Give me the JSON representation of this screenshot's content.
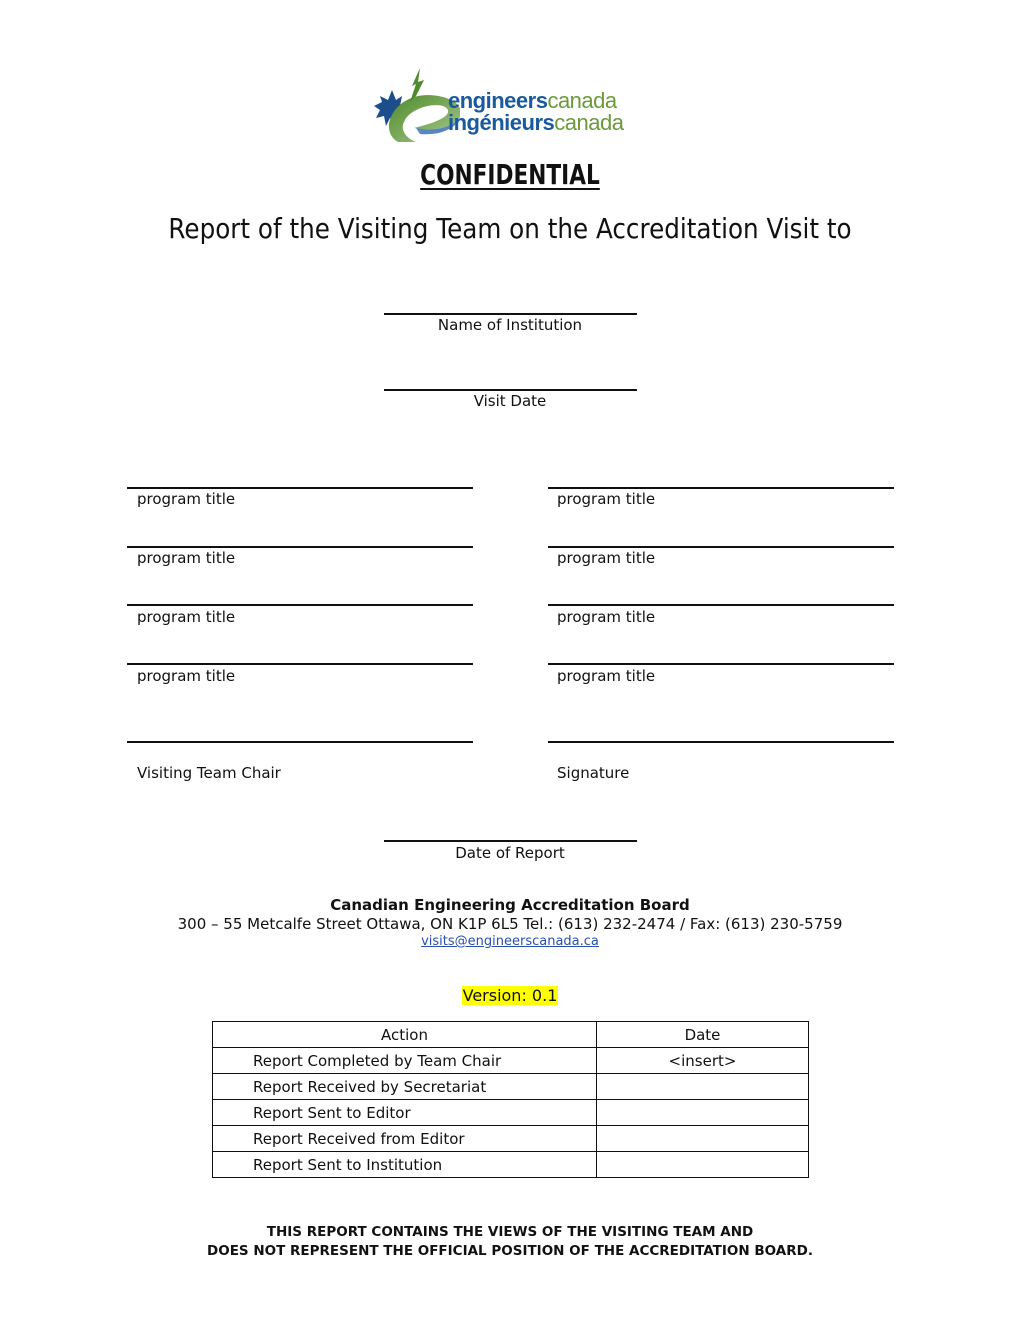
{
  "logo": {
    "line1_bold": "engineers",
    "line1_light": "canada",
    "line2_bold": "ingénieurs",
    "line2_light": "canada"
  },
  "header": {
    "confidential": "CONFIDENTIAL",
    "title": "Report of the Visiting Team on the Accreditation Visit to"
  },
  "fields": {
    "institution_label": "Name of Institution",
    "visit_date_label": "Visit Date"
  },
  "programs": {
    "left": [
      "program title",
      "program title",
      "program title",
      "program title"
    ],
    "right": [
      "program title",
      "program title",
      "program title",
      "program title"
    ]
  },
  "signatures": {
    "chair_label": "Visiting Team Chair",
    "signature_label": "Signature",
    "date_of_report_label": "Date of Report"
  },
  "contact": {
    "organization": "Canadian Engineering Accreditation Board",
    "address": "300 – 55 Metcalfe Street Ottawa, ON K1P 6L5 Tel.: (613) 232-2474 / Fax: (613) 230-5759",
    "email": "visits@engineerscanada.ca"
  },
  "version": {
    "text": "Version:  0.1",
    "highlight_color": "#ffff00"
  },
  "log_table": {
    "headers": [
      "Action",
      "Date"
    ],
    "rows": [
      {
        "action": "Report Completed by Team Chair",
        "date": "<insert>"
      },
      {
        "action": "Report Received by Secretariat",
        "date": ""
      },
      {
        "action": "Report Sent to Editor",
        "date": ""
      },
      {
        "action": "Report Received from Editor",
        "date": ""
      },
      {
        "action": "Report Sent to Institution",
        "date": ""
      }
    ]
  },
  "disclaimer": {
    "line1": "THIS REPORT CONTAINS THE VIEWS OF THE VISITING TEAM AND",
    "line2": "DOES NOT REPRESENT THE OFFICIAL POSITION OF THE ACCREDITATION BOARD."
  }
}
